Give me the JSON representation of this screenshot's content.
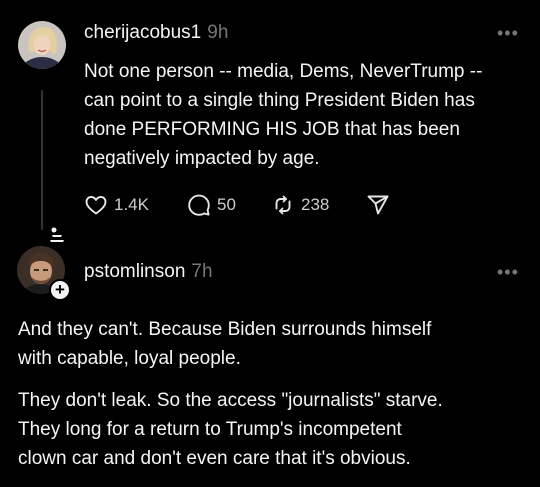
{
  "post1": {
    "username": "cherijacobus1",
    "time": "9h",
    "more_glyph": "•••",
    "lines": [
      "Not one person -- media, Dems, NeverTrump --",
      "can point to a single thing President Biden has",
      "done PERFORMING HIS JOB that has been",
      "negatively impacted by age."
    ],
    "likes": "1.4K",
    "comments": "50",
    "reposts": "238",
    "icons": {
      "like": "heart-icon",
      "comment": "comment-icon",
      "repost": "repost-icon",
      "share": "send-icon"
    }
  },
  "post2": {
    "username": "pstomlinson",
    "time": "7h",
    "more_glyph": "•••",
    "follow_glyph": "+",
    "paragraphs": [
      [
        "And they can't. Because Biden surrounds himself",
        "with capable, loyal people."
      ],
      [
        "They don't leak. So the access \"journalists\" starve.",
        "They long for a return to Trump's incompetent",
        "clown car and don't even care that it's obvious."
      ]
    ]
  },
  "colors": {
    "background": "#000000",
    "text": "#f3f5f7",
    "muted": "#777777",
    "thread_line": "#333638"
  }
}
